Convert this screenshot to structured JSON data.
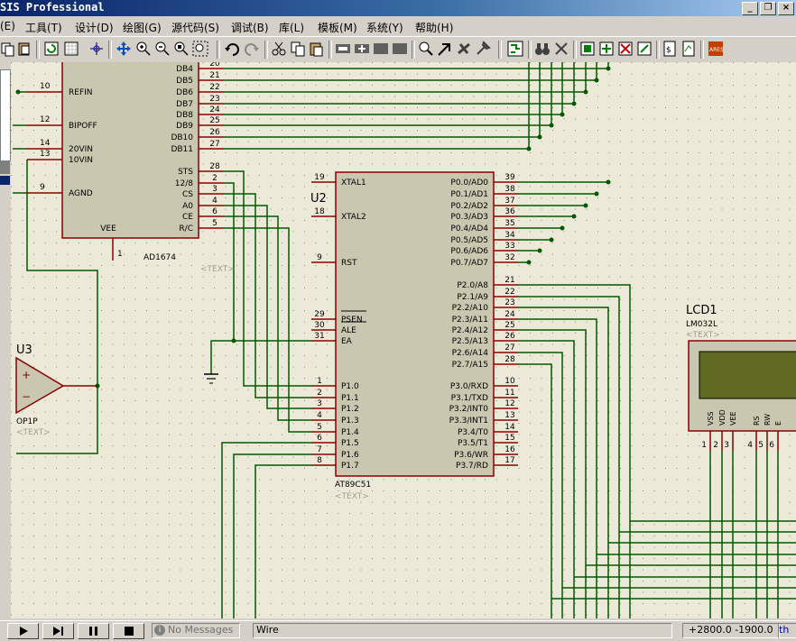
{
  "window": {
    "title": "SIS Professional"
  },
  "menu": {
    "items": [
      "(E)",
      "工具(T)",
      "设计(D)",
      "绘图(G)",
      "源代码(S)",
      "调试(B)",
      "库(L)",
      "模板(M)",
      "系统(Y)",
      "帮助(H)"
    ]
  },
  "toolbar": {
    "icons": [
      "copy",
      "paste",
      "refresh",
      "grid",
      "origin",
      "pan",
      "zoom-in",
      "zoom-out",
      "zoom-all",
      "zoom-area",
      "undo",
      "redo",
      "cut",
      "copy",
      "paste",
      "block-copy",
      "block-move",
      "block-rotate",
      "block-delete",
      "pick-device",
      "autoroute",
      "search",
      "property-assign",
      "new-sheet",
      "remove-sheet",
      "bom",
      "netlist",
      "ares"
    ]
  },
  "schematic": {
    "adc": {
      "name": "AD1674",
      "text": "<TEXT>",
      "left_pins": [
        {
          "num": "10",
          "label": "REFIN"
        },
        {
          "num": "12",
          "label": "BIPOFF"
        },
        {
          "num": "14",
          "label": "20VIN"
        },
        {
          "num": "13",
          "label": "10VIN"
        },
        {
          "num": "9",
          "label": "AGND"
        }
      ],
      "right_pins": [
        {
          "num": "20",
          "label": "DB4"
        },
        {
          "num": "21",
          "label": "DB5"
        },
        {
          "num": "22",
          "label": "DB6"
        },
        {
          "num": "23",
          "label": "DB7"
        },
        {
          "num": "24",
          "label": "DB8"
        },
        {
          "num": "25",
          "label": "DB9"
        },
        {
          "num": "26",
          "label": "DB10"
        },
        {
          "num": "27",
          "label": "DB11"
        },
        {
          "num": "28",
          "label": "STS"
        },
        {
          "num": "2",
          "label": "12/8"
        },
        {
          "num": "3",
          "label": "CS"
        },
        {
          "num": "4",
          "label": "A0"
        },
        {
          "num": "6",
          "label": "CE"
        },
        {
          "num": "5",
          "label": "R/C"
        }
      ],
      "bottom_pin": {
        "num": "1",
        "label": "VEE"
      }
    },
    "mcu": {
      "ref": "U2",
      "name": "AT89C51",
      "text": "<TEXT>",
      "left_pins": [
        {
          "num": "19",
          "label": "XTAL1"
        },
        {
          "num": "18",
          "label": "XTAL2"
        },
        {
          "num": "9",
          "label": "RST"
        },
        {
          "num": "29",
          "label": "PSEN"
        },
        {
          "num": "30",
          "label": "ALE"
        },
        {
          "num": "31",
          "label": "EA"
        },
        {
          "num": "1",
          "label": "P1.0"
        },
        {
          "num": "2",
          "label": "P1.1"
        },
        {
          "num": "3",
          "label": "P1.2"
        },
        {
          "num": "4",
          "label": "P1.3"
        },
        {
          "num": "5",
          "label": "P1.4"
        },
        {
          "num": "6",
          "label": "P1.5"
        },
        {
          "num": "7",
          "label": "P1.6"
        },
        {
          "num": "8",
          "label": "P1.7"
        }
      ],
      "right_pins": [
        {
          "num": "39",
          "label": "P0.0/AD0"
        },
        {
          "num": "38",
          "label": "P0.1/AD1"
        },
        {
          "num": "37",
          "label": "P0.2/AD2"
        },
        {
          "num": "36",
          "label": "P0.3/AD3"
        },
        {
          "num": "35",
          "label": "P0.4/AD4"
        },
        {
          "num": "34",
          "label": "P0.5/AD5"
        },
        {
          "num": "33",
          "label": "P0.6/AD6"
        },
        {
          "num": "32",
          "label": "P0.7/AD7"
        },
        {
          "num": "21",
          "label": "P2.0/A8"
        },
        {
          "num": "22",
          "label": "P2.1/A9"
        },
        {
          "num": "23",
          "label": "P2.2/A10"
        },
        {
          "num": "24",
          "label": "P2.3/A11"
        },
        {
          "num": "25",
          "label": "P2.4/A12"
        },
        {
          "num": "26",
          "label": "P2.5/A13"
        },
        {
          "num": "27",
          "label": "P2.6/A14"
        },
        {
          "num": "28",
          "label": "P2.7/A15"
        },
        {
          "num": "10",
          "label": "P3.0/RXD"
        },
        {
          "num": "11",
          "label": "P3.1/TXD"
        },
        {
          "num": "12",
          "label": "P3.2/INT0"
        },
        {
          "num": "13",
          "label": "P3.3/INT1"
        },
        {
          "num": "14",
          "label": "P3.4/T0"
        },
        {
          "num": "15",
          "label": "P3.5/T1"
        },
        {
          "num": "16",
          "label": "P3.6/WR"
        },
        {
          "num": "17",
          "label": "P3.7/RD"
        }
      ]
    },
    "opamp": {
      "ref": "U3",
      "name": "OP1P",
      "text": "<TEXT>",
      "plus": "+",
      "minus": "−"
    },
    "lcd": {
      "ref": "LCD1",
      "name": "LM032L",
      "text": "<TEXT>",
      "pins": [
        "VSS",
        "VDD",
        "VEE",
        "RS",
        "RW",
        "E"
      ],
      "pin_nums": [
        "1",
        "2",
        "3",
        "4",
        "5",
        "6"
      ]
    },
    "text_placeholder": "<TEXT>"
  },
  "status": {
    "messages": "No Messages",
    "mode": "Wire",
    "coords": "+2800.0  -1900.0",
    "unit": "th"
  },
  "colors": {
    "wire": "#005900",
    "body": "#c9c7b0",
    "pin": "#8b0000",
    "bg": "#ece9d8"
  }
}
